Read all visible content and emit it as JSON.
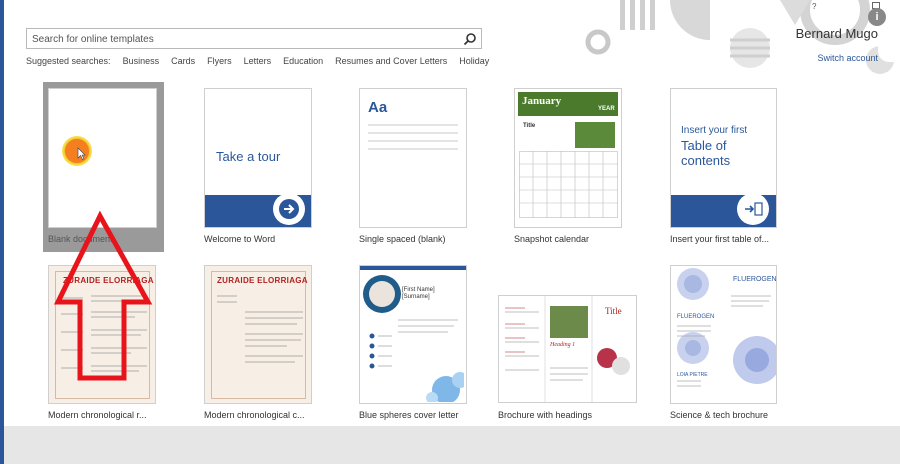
{
  "search": {
    "placeholder": "Search for online templates"
  },
  "suggested": {
    "label": "Suggested searches:",
    "items": [
      "Business",
      "Cards",
      "Flyers",
      "Letters",
      "Education",
      "Resumes and Cover Letters",
      "Holiday"
    ]
  },
  "user": {
    "name": "Bernard Mugo",
    "switch_label": "Switch account"
  },
  "window": {
    "help": "?",
    "info": "i"
  },
  "templates": [
    {
      "label": "Blank document"
    },
    {
      "label": "Welcome to Word",
      "text": "Take a tour"
    },
    {
      "label": "Single spaced (blank)",
      "text": "Aa"
    },
    {
      "label": "Snapshot calendar",
      "text": "January",
      "year": "YEAR",
      "title": "Title"
    },
    {
      "label": "Insert your first table of...",
      "text": "Insert your first",
      "big": "Table of contents"
    },
    {
      "label": "Modern chronological r...",
      "name": "ZURAIDE ELORRIAGA"
    },
    {
      "label": "Modern chronological c...",
      "name": "ZURAIDE ELORRIAGA"
    },
    {
      "label": "Blue spheres cover letter",
      "name": "[First Name]",
      "surname": "[Surname]"
    },
    {
      "label": "Brochure with headings",
      "title": "Title",
      "heading": "Heading 1"
    },
    {
      "label": "Science & tech brochure",
      "brand": "FLUEROGEN",
      "person": "LOIA PIETRE"
    }
  ],
  "colors": {
    "accent": "#2b579a",
    "resume_red": "#b22222",
    "annotation": "#e8141b"
  }
}
